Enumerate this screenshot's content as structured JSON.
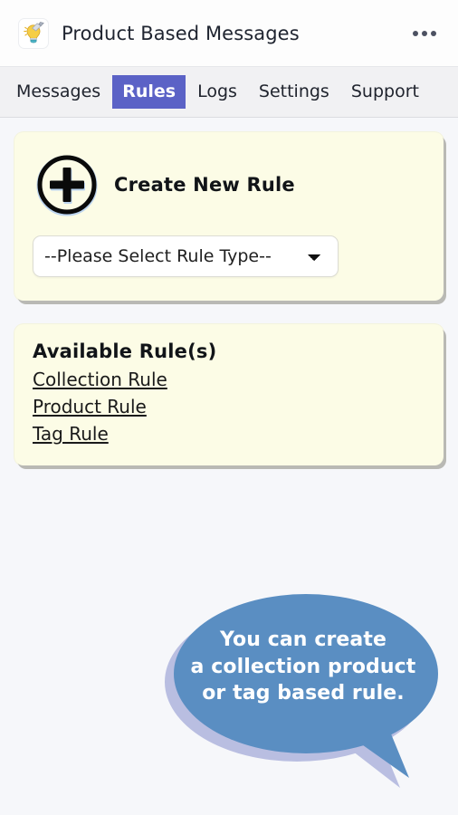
{
  "header": {
    "title": "Product Based Messages",
    "logo_icon": "lightbulb-icon",
    "menu_icon": "more-options-icon"
  },
  "tabs": [
    {
      "label": "Messages",
      "active": false
    },
    {
      "label": "Rules",
      "active": true
    },
    {
      "label": "Logs",
      "active": false
    },
    {
      "label": "Settings",
      "active": false
    },
    {
      "label": "Support",
      "active": false
    }
  ],
  "create_card": {
    "plus_icon": "plus-circle-icon",
    "title": "Create New Rule",
    "select": {
      "selected": "--Please Select Rule Type--",
      "chevron_icon": "chevron-down-icon",
      "options": [
        "--Please Select Rule Type--"
      ]
    }
  },
  "available_card": {
    "title": "Available Rule(s)",
    "rules": [
      "Collection Rule",
      "Product Rule",
      "Tag Rule"
    ]
  },
  "callout": {
    "lines": [
      "You can create",
      "a collection product",
      "or tag based rule."
    ]
  },
  "colors": {
    "page_background": "#f6f7fa",
    "header_background": "#fdfdfd",
    "tabbar_background": "#f1f1f3",
    "active_tab": "#5b62c6",
    "card_background": "#fcfce6",
    "card_shadow": "#b9b9b4",
    "bubble_fill": "#5a8ec2",
    "bubble_shadow": "#b9bee1",
    "text_primary": "#1f2430"
  }
}
